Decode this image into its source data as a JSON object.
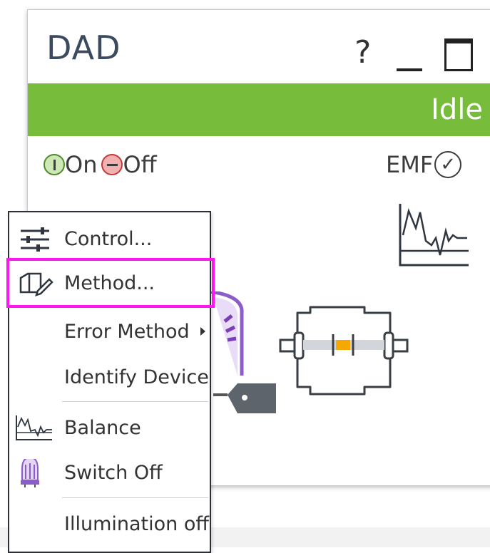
{
  "window": {
    "title": "DAD",
    "help_label": "?",
    "status": "Idle",
    "on_label": "On",
    "off_label": "Off",
    "emf_label": "EMF",
    "check_glyph": "✓"
  },
  "icons": {
    "balance_chart": "balance-chart-icon",
    "lamp": "lamp-icon",
    "tag": "tag-icon",
    "flow_cell": "flow-cell-icon"
  },
  "context_menu": {
    "items": [
      {
        "label": "Control...",
        "icon": "sliders-icon"
      },
      {
        "label": "Method...",
        "icon": "method-edit-icon",
        "highlighted": true
      },
      {
        "label": "Error Method",
        "submenu": true
      },
      {
        "label": "Identify Device"
      },
      {
        "label": "Balance",
        "icon": "balance-chart-icon"
      },
      {
        "label": "Switch Off",
        "icon": "lamp-icon"
      },
      {
        "label": "Illumination off"
      }
    ]
  },
  "colors": {
    "status_green": "#77bc3a",
    "highlight_magenta": "#ff16f0",
    "title_blue": "#3b4a5e",
    "lamp_purple": "#7a3fb5",
    "cell_orange": "#f5a800"
  }
}
